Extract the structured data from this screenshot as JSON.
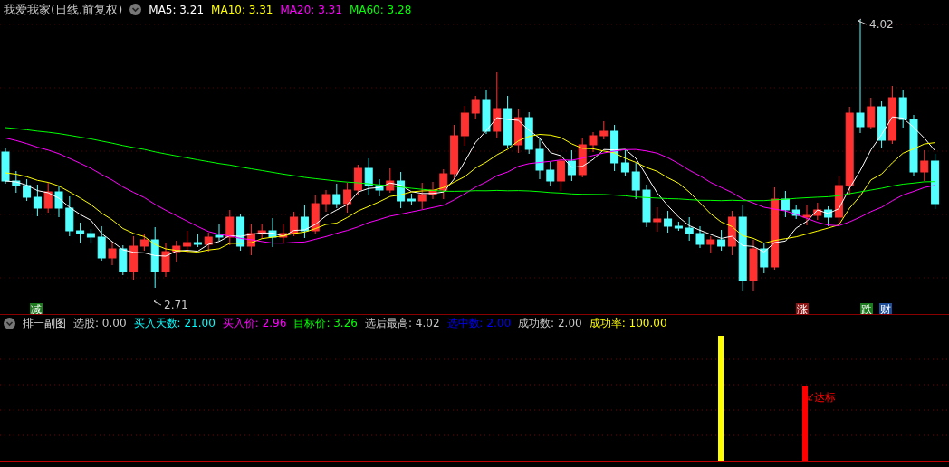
{
  "chart_title": "我爱我家(日线.前复权)",
  "ma_legend": [
    {
      "label": "MA5:",
      "value": "3.21",
      "color": "#ffffff"
    },
    {
      "label": "MA10:",
      "value": "3.31",
      "color": "#ffff00"
    },
    {
      "label": "MA20:",
      "value": "3.31",
      "color": "#ff00ff"
    },
    {
      "label": "MA60:",
      "value": "3.28",
      "color": "#00ff00"
    }
  ],
  "price_annotations": [
    {
      "kind": "high",
      "text": "4.02"
    },
    {
      "kind": "low",
      "text": "2.71"
    }
  ],
  "signal_tags": [
    {
      "text": "减",
      "color": "#1e7a1e"
    },
    {
      "text": "涨",
      "color": "#8c1414"
    },
    {
      "text": "跌",
      "color": "#1e7a1e"
    },
    {
      "text": "财",
      "color": "#1e4e9a"
    }
  ],
  "indicator": {
    "title": "排一副图",
    "stats": [
      {
        "label": "选股:",
        "value": "0.00",
        "color": "#c8c8c8"
      },
      {
        "label": "买入天数:",
        "value": "21.00",
        "color": "#00ffff"
      },
      {
        "label": "买入价:",
        "value": "2.96",
        "color": "#ff00ff"
      },
      {
        "label": "目标价:",
        "value": "3.26",
        "color": "#00ff00"
      },
      {
        "label": "选后最高:",
        "value": "4.02",
        "color": "#c8c8c8"
      },
      {
        "label": "选中数:",
        "value": "2.00",
        "color": "#0000ff"
      },
      {
        "label": "成功数:",
        "value": "2.00",
        "color": "#c8c8c8"
      },
      {
        "label": "成功率:",
        "value": "100.00",
        "color": "#ffff00"
      }
    ]
  },
  "indicator_bars": [
    {
      "color": "#ffff00"
    },
    {
      "color": "#ff0000",
      "label": "达标"
    }
  ]
}
